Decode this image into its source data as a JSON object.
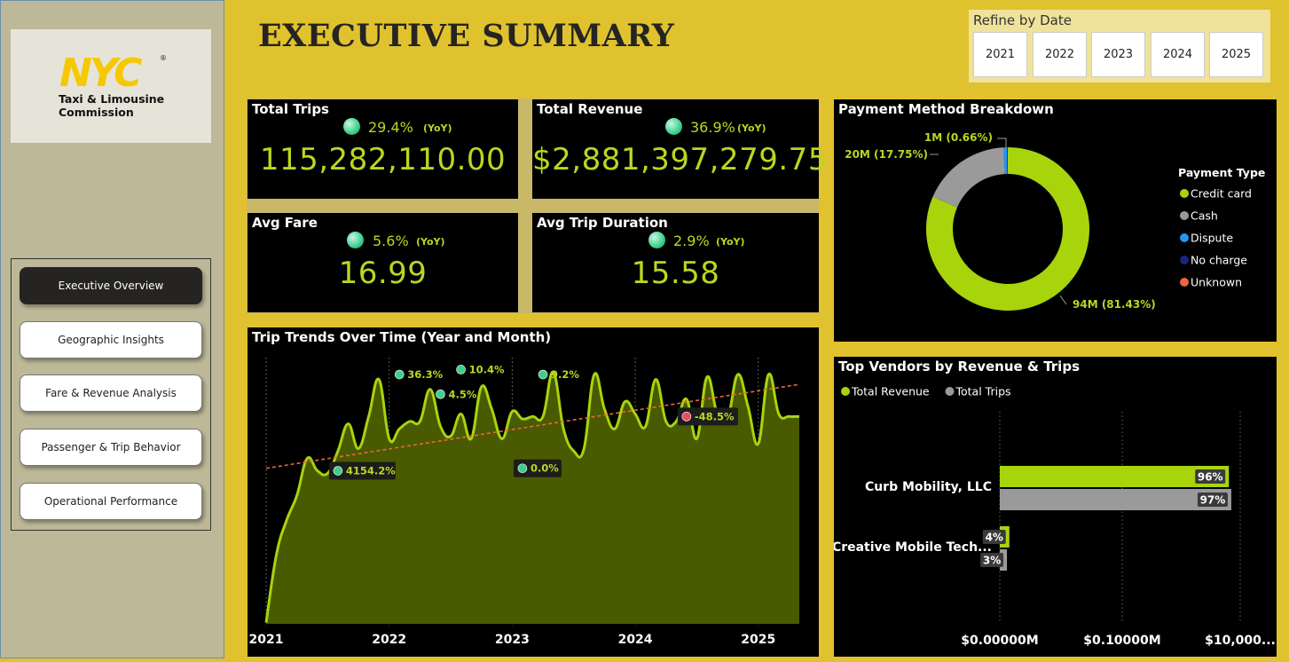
{
  "logo": {
    "mark": "NYC",
    "reg": "®",
    "line1": "Taxi & Limousine",
    "line2": "Commission"
  },
  "nav": {
    "items": [
      {
        "label": "Executive Overview",
        "active": true
      },
      {
        "label": "Geographic Insights",
        "active": false
      },
      {
        "label": "Fare & Revenue Analysis",
        "active": false
      },
      {
        "label": "Passenger & Trip Behavior",
        "active": false
      },
      {
        "label": "Operational Performance",
        "active": false
      }
    ]
  },
  "header": {
    "title": "EXECUTIVE SUMMARY"
  },
  "date_filter": {
    "title": "Refine by Date",
    "years": [
      "2021",
      "2022",
      "2023",
      "2024",
      "2025"
    ]
  },
  "kpis": {
    "total_trips": {
      "title": "Total Trips",
      "pct": "29.4%",
      "yoy": "(YoY)",
      "value": "115,282,110.00"
    },
    "total_revenue": {
      "title": "Total Revenue",
      "pct": "36.9%",
      "yoy": "(YoY)",
      "value": "$2,881,397,279.75"
    },
    "avg_fare": {
      "title": "Avg Fare",
      "pct": "5.6%",
      "yoy": "(YoY)",
      "value": "16.99"
    },
    "avg_trip_duration": {
      "title": "Avg Trip Duration",
      "pct": "2.9%",
      "yoy": "(YoY)",
      "value": "15.58"
    }
  },
  "colors": {
    "accent": "#b8d820",
    "lime": "#a8d40c",
    "gray": "#9a9a9a",
    "dispute": "#2196f3",
    "no_charge": "#1a237e",
    "unknown": "#e8673c",
    "positive": "#3ecf8e",
    "negative": "#e84a5f",
    "trend": "#e8673c"
  },
  "chart_data": [
    {
      "type": "area",
      "title": "Trip Trends Over Time (Year and Month)",
      "x_ticks": [
        "2021",
        "2022",
        "2023",
        "2024",
        "2025"
      ],
      "x": [
        "2021-01",
        "2021-02",
        "2021-03",
        "2021-04",
        "2021-05",
        "2021-06",
        "2021-07",
        "2021-08",
        "2021-09",
        "2021-10",
        "2021-11",
        "2021-12",
        "2022-01",
        "2022-02",
        "2022-03",
        "2022-04",
        "2022-05",
        "2022-06",
        "2022-07",
        "2022-08",
        "2022-09",
        "2022-10",
        "2022-11",
        "2022-12",
        "2023-01",
        "2023-02",
        "2023-03",
        "2023-04",
        "2023-05",
        "2023-06",
        "2023-07",
        "2023-08",
        "2023-09",
        "2023-10",
        "2023-11",
        "2023-12",
        "2024-01",
        "2024-02",
        "2024-03",
        "2024-04",
        "2024-05",
        "2024-06",
        "2024-07",
        "2024-08",
        "2024-09",
        "2024-10",
        "2024-11",
        "2024-12",
        "2025-01",
        "2025-02",
        "2025-03",
        "2025-04",
        "2025-05"
      ],
      "values": [
        0.5,
        28,
        42,
        52,
        67,
        62,
        61,
        70,
        81,
        71,
        84,
        99,
        75,
        79,
        82,
        82,
        95,
        80,
        76,
        85,
        75,
        96,
        87,
        75,
        86,
        83,
        84,
        84,
        102,
        79,
        70,
        71,
        101,
        87,
        79,
        90,
        85,
        80,
        99,
        82,
        82,
        91,
        75,
        100,
        85,
        83,
        101,
        88,
        73,
        101,
        85,
        84,
        84
      ],
      "trend": {
        "start": 63,
        "end": 97
      },
      "ylim": [
        0,
        110
      ],
      "annotations": [
        {
          "label": "4154.2%",
          "i": 7,
          "y": 62,
          "positive": true,
          "boxed": true
        },
        {
          "label": "36.3%",
          "i": 13,
          "y": 101,
          "positive": true,
          "boxed": false
        },
        {
          "label": "4.5%",
          "i": 17,
          "y": 93,
          "positive": true,
          "boxed": false
        },
        {
          "label": "10.4%",
          "i": 19,
          "y": 103,
          "positive": true,
          "boxed": false
        },
        {
          "label": "0.0%",
          "i": 25,
          "y": 63,
          "positive": true,
          "boxed": true
        },
        {
          "label": "9.2%",
          "i": 27,
          "y": 101,
          "positive": true,
          "boxed": false
        },
        {
          "label": "-48.5%",
          "i": 41,
          "y": 84,
          "positive": false,
          "boxed": true
        }
      ]
    },
    {
      "type": "pie",
      "title": "Payment Method Breakdown",
      "legend_title": "Payment Type",
      "legend_position": "right",
      "slices": [
        {
          "name": "Credit card",
          "value": 81.43,
          "label": "94M (81.43%)"
        },
        {
          "name": "Cash",
          "value": 17.75,
          "label": "20M (17.75%)"
        },
        {
          "name": "Dispute",
          "value": 0.66,
          "label": "1M (0.66%)"
        },
        {
          "name": "No charge",
          "value": 0.12,
          "label": ""
        },
        {
          "name": "Unknown",
          "value": 0.04,
          "label": ""
        }
      ]
    },
    {
      "type": "bar",
      "title": "Top Vendors by Revenue & Trips",
      "legend_position": "top-left",
      "categories": [
        "Curb Mobility, LLC",
        "Creative Mobile Tech..."
      ],
      "series": [
        {
          "name": "Total Revenue",
          "values": [
            96,
            4
          ],
          "labels": [
            "96%",
            "4%"
          ]
        },
        {
          "name": "Total Trips",
          "values": [
            97,
            3
          ],
          "labels": [
            "97%",
            "3%"
          ]
        }
      ],
      "x_ticks": [
        "$0.00000M",
        "$0.10000M",
        "$10,000..."
      ]
    }
  ]
}
